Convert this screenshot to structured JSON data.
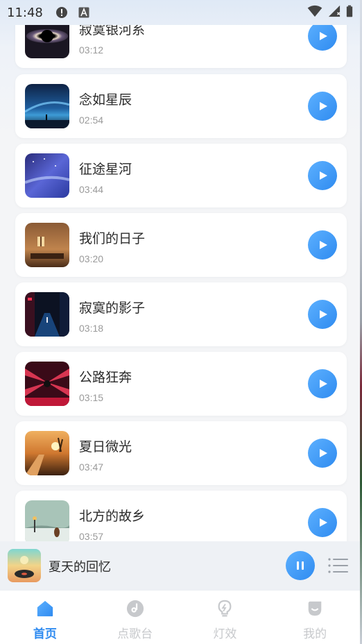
{
  "status_bar": {
    "time": "11:48",
    "icons": [
      "alert-icon",
      "font-a-icon",
      "wifi-icon",
      "signal-icon",
      "battery-icon"
    ]
  },
  "songs": [
    {
      "title": "寂寞银河系",
      "duration": "03:12",
      "cover": "galaxy-ring-cover"
    },
    {
      "title": "念如星辰",
      "duration": "02:54",
      "cover": "starry-night-cover"
    },
    {
      "title": "征途星河",
      "duration": "03:44",
      "cover": "milky-way-cover"
    },
    {
      "title": "我们的日子",
      "duration": "03:20",
      "cover": "warm-room-cover"
    },
    {
      "title": "寂寞的影子",
      "duration": "03:18",
      "cover": "neon-alley-cover"
    },
    {
      "title": "公路狂奔",
      "duration": "03:15",
      "cover": "red-tunnel-cover"
    },
    {
      "title": "夏日微光",
      "duration": "03:47",
      "cover": "sunset-road-cover"
    },
    {
      "title": "北方的故乡",
      "duration": "03:57",
      "cover": "snow-field-cover"
    }
  ],
  "mini_player": {
    "title": "夏天的回忆",
    "cover": "summer-vinyl-cover",
    "state": "playing"
  },
  "tabs": [
    {
      "label": "首页",
      "icon": "home-icon",
      "active": true
    },
    {
      "label": "点歌台",
      "icon": "music-disc-icon",
      "active": false
    },
    {
      "label": "灯效",
      "icon": "light-bulb-icon",
      "active": false
    },
    {
      "label": "我的",
      "icon": "profile-icon",
      "active": false
    }
  ],
  "colors": {
    "accent": "#2f8bf0",
    "inactive_tab": "#c7c9cc",
    "duration_text": "#9a9a9a"
  }
}
